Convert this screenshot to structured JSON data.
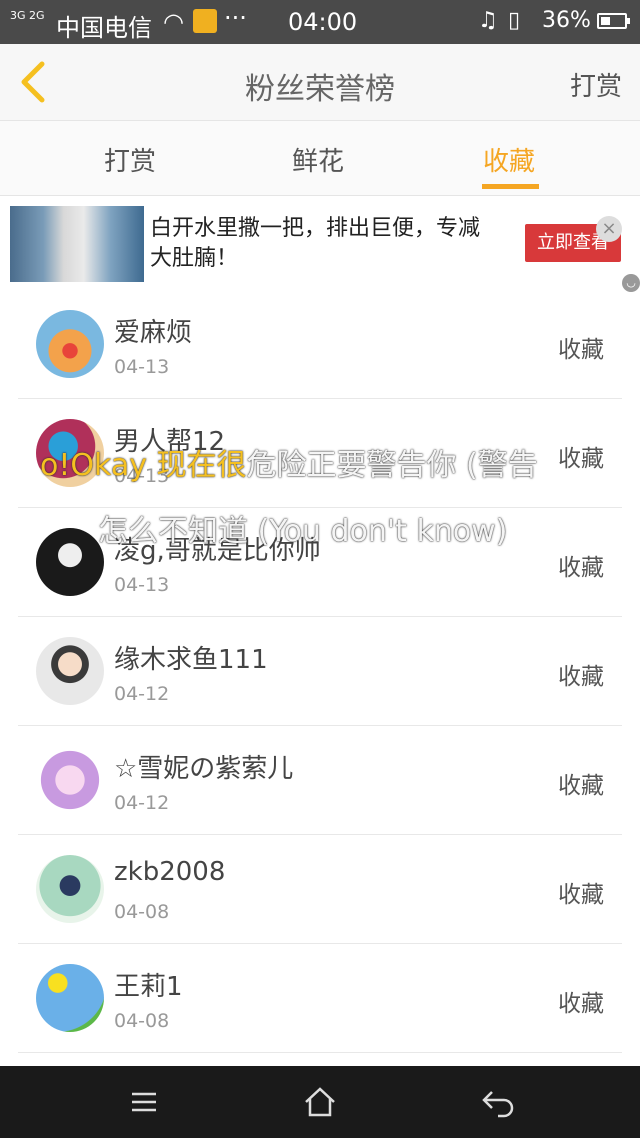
{
  "status_bar": {
    "signal": "3G 2G",
    "carrier": "中国电信",
    "time": "04:00",
    "battery": "36%"
  },
  "header": {
    "title": "粉丝荣誉榜",
    "action": "打赏"
  },
  "tabs": [
    {
      "label": "打赏",
      "active": false
    },
    {
      "label": "鲜花",
      "active": false
    },
    {
      "label": "收藏",
      "active": true
    }
  ],
  "ad": {
    "text": "白开水里撒一把，排出巨便，专减大肚腩！",
    "button": "立即查看"
  },
  "rows": [
    {
      "name": "爱麻烦",
      "date": "04-13",
      "action": "收藏"
    },
    {
      "name": "男人帮12",
      "date": "04-13",
      "action": "收藏"
    },
    {
      "name": "凌g,哥就是比你帅",
      "date": "04-13",
      "action": "收藏"
    },
    {
      "name": "缘木求鱼111",
      "date": "04-12",
      "action": "收藏"
    },
    {
      "name": "☆雪妮の紫萦儿",
      "date": "04-12",
      "action": "收藏"
    },
    {
      "name": "zkb2008",
      "date": "04-08",
      "action": "收藏"
    },
    {
      "name": "王莉1",
      "date": "04-08",
      "action": "收藏"
    }
  ],
  "lyrics": {
    "line1_highlight": "o!Okay 现在很",
    "line1_rest": "危险正要警告你 (警告",
    "line2": "怎么不知道 (You don't know)"
  },
  "colors": {
    "accent": "#f5a623",
    "ad_button": "#d8393a"
  }
}
